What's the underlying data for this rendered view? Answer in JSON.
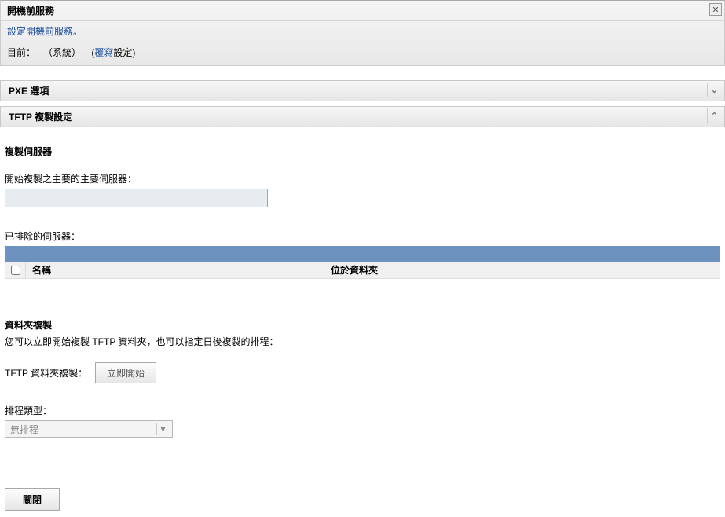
{
  "header": {
    "title": "開機前服務",
    "desc": "設定開機前服務。",
    "current_label": "目前：",
    "current_value": "（系統）",
    "override_prefix": "(",
    "override_link": "覆寫",
    "override_suffix": "設定)",
    "close_icon": "✕"
  },
  "sections": {
    "pxe": {
      "title": "PXE 選項",
      "toggle": "⌄"
    },
    "tftp": {
      "title": "TFTP 複製設定",
      "toggle": "⌃"
    }
  },
  "replication": {
    "server_title": "複製伺服器",
    "primary_label": "開始複製之主要的主要伺服器：",
    "primary_value": "",
    "excluded_label": "已排除的伺服器：",
    "table": {
      "name_header": "名稱",
      "folder_header": "位於資料夾"
    }
  },
  "folder_rep": {
    "title": "資料夾複製",
    "desc": "您可以立即開始複製 TFTP 資料夾，也可以指定日後複製的排程：",
    "copy_label": "TFTP 資料夾複製：",
    "start_btn": "立即開始",
    "schedule_label": "排程類型：",
    "schedule_value": "無排程"
  },
  "footer": {
    "close_btn": "關閉"
  }
}
